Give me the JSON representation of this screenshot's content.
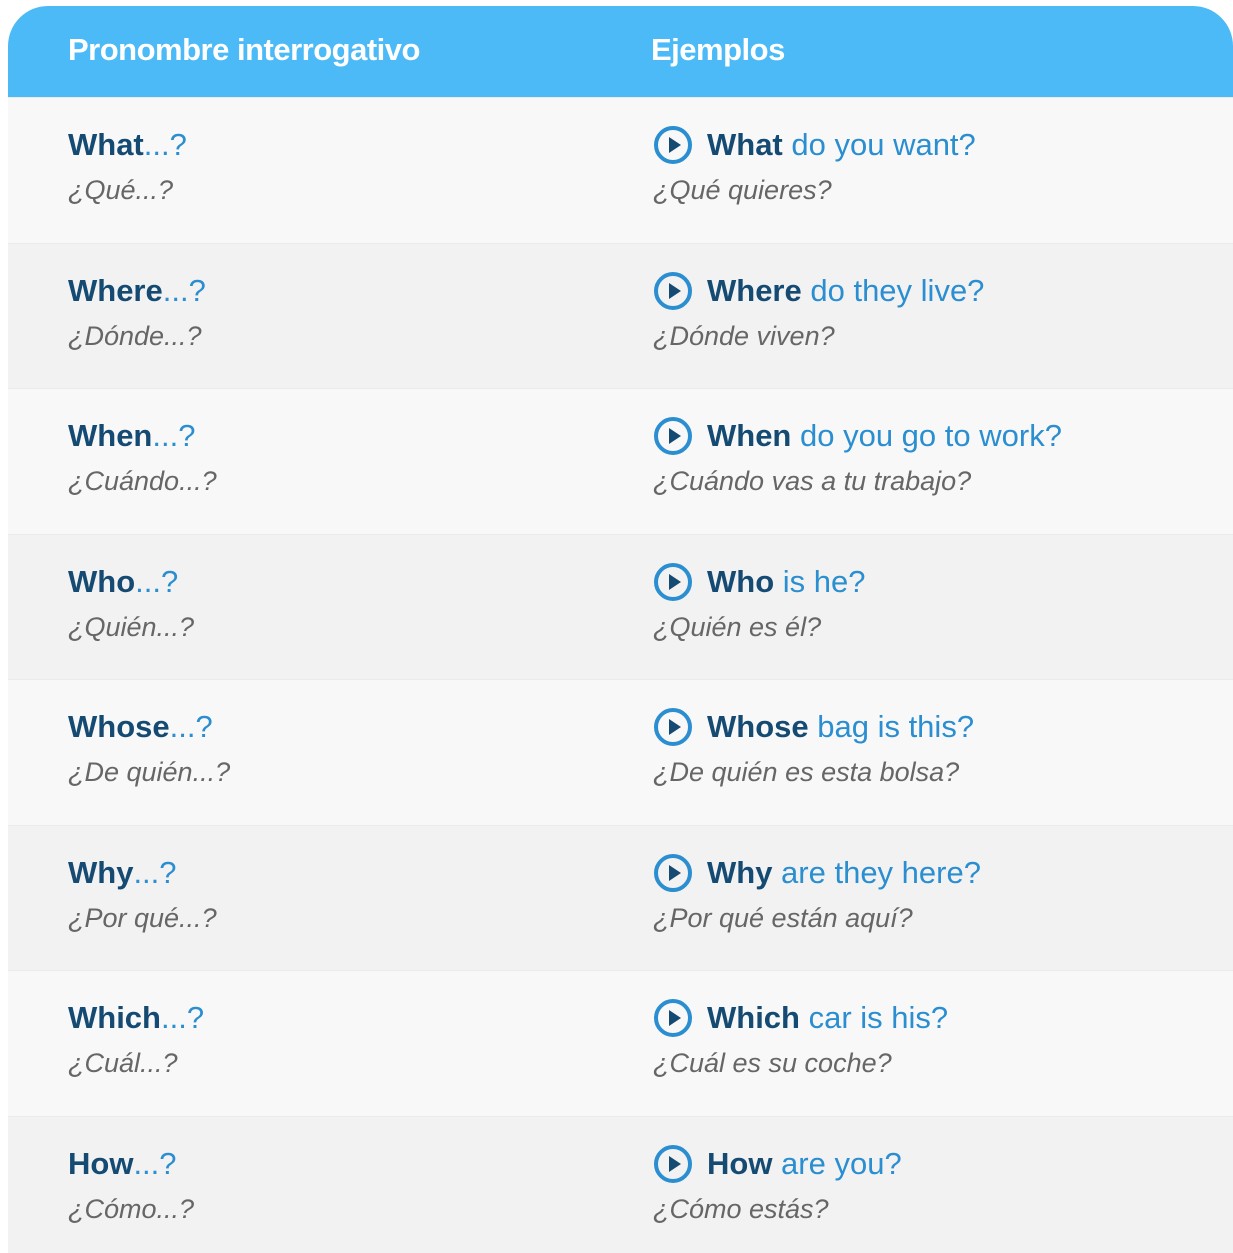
{
  "header": {
    "col1": "Pronombre interrogativo",
    "col2": "Ejemplos"
  },
  "colors": {
    "header_bg": "#4bbaf6",
    "keyword": "#154a73",
    "rest_text": "#2a8ed1",
    "translation": "#666666"
  },
  "rows": [
    {
      "pronoun": "What",
      "pronoun_suffix": "...?",
      "pronoun_es": "¿Qué...?",
      "ex_kw": "What",
      "ex_rest": " do you want?",
      "ex_es": "¿Qué quieres?"
    },
    {
      "pronoun": "Where",
      "pronoun_suffix": "...?",
      "pronoun_es": "¿Dónde...?",
      "ex_kw": "Where",
      "ex_rest": " do they live?",
      "ex_es": "¿Dónde viven?"
    },
    {
      "pronoun": "When",
      "pronoun_suffix": "...?",
      "pronoun_es": "¿Cuándo...?",
      "ex_kw": "When",
      "ex_rest": " do you go to work?",
      "ex_es": "¿Cuándo vas a tu trabajo?"
    },
    {
      "pronoun": "Who",
      "pronoun_suffix": "...?",
      "pronoun_es": "¿Quién...?",
      "ex_kw": "Who",
      "ex_rest": " is he?",
      "ex_es": "¿Quién es él?"
    },
    {
      "pronoun": "Whose",
      "pronoun_suffix": "...?",
      "pronoun_es": "¿De quién...?",
      "ex_kw": "Whose",
      "ex_rest": " bag is this?",
      "ex_es": "¿De quién es esta bolsa?"
    },
    {
      "pronoun": "Why",
      "pronoun_suffix": "...?",
      "pronoun_es": "¿Por qué...?",
      "ex_kw": "Why",
      "ex_rest": " are they here?",
      "ex_es": "¿Por qué están aquí?"
    },
    {
      "pronoun": "Which",
      "pronoun_suffix": "...?",
      "pronoun_es": "¿Cuál...?",
      "ex_kw": "Which",
      "ex_rest": " car is his?",
      "ex_es": "¿Cuál es su coche?"
    },
    {
      "pronoun": "How",
      "pronoun_suffix": "...?",
      "pronoun_es": "¿Cómo...?",
      "ex_kw": "How",
      "ex_rest": " are you?",
      "ex_es": "¿Cómo estás?"
    }
  ]
}
